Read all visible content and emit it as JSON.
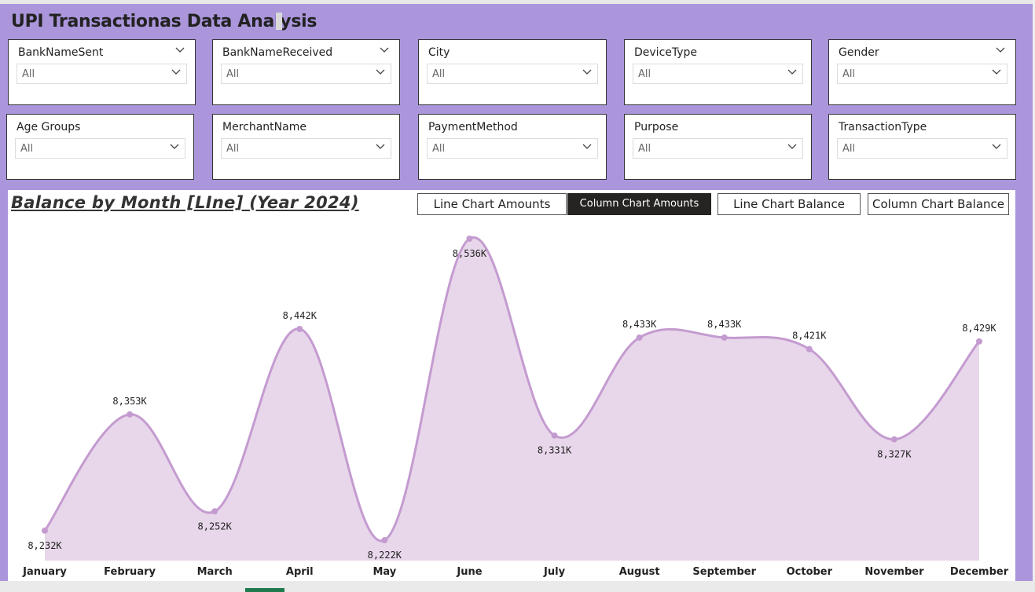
{
  "report_title": "UPI Transactionas Data Analysis",
  "slicers": [
    {
      "label": "BankNameSent",
      "value": "All",
      "header_chevron": true
    },
    {
      "label": "BankNameReceived",
      "value": "All",
      "header_chevron": true
    },
    {
      "label": "City",
      "value": "All",
      "header_chevron": false
    },
    {
      "label": "DeviceType",
      "value": "All",
      "header_chevron": false
    },
    {
      "label": "Gender",
      "value": "All",
      "header_chevron": true
    },
    {
      "label": "Age Groups",
      "value": "All",
      "header_chevron": false
    },
    {
      "label": "MerchantName",
      "value": "All",
      "header_chevron": false
    },
    {
      "label": "PaymentMethod",
      "value": "All",
      "header_chevron": false
    },
    {
      "label": "Purpose",
      "value": "All",
      "header_chevron": false
    },
    {
      "label": "TransactionType",
      "value": "All",
      "header_chevron": false
    }
  ],
  "buttons": [
    {
      "label": "Line Chart Amounts",
      "active": false
    },
    {
      "label": "Column Chart Amounts",
      "active": true
    },
    {
      "label": "Line Chart Balance",
      "active": false
    },
    {
      "label": "Column Chart Balance",
      "active": false
    }
  ],
  "colors": {
    "canvas": "#ab96dc",
    "line": "#c49bd0",
    "area": "#e8d7ea",
    "active_button": "#252423"
  },
  "chart_data": {
    "type": "area",
    "title": "Balance by Month [LIne] (Year 2024)",
    "xlabel": "",
    "ylabel": "",
    "categories": [
      "January",
      "February",
      "March",
      "April",
      "May",
      "June",
      "July",
      "August",
      "September",
      "October",
      "November",
      "December"
    ],
    "values": [
      8232,
      8353,
      8252,
      8442,
      8222,
      8536,
      8331,
      8433,
      8433,
      8421,
      8327,
      8429
    ],
    "data_labels": [
      "8,232K",
      "8,353K",
      "8,252K",
      "8,442K",
      "8,222K",
      "8,536K",
      "8,331K",
      "8,433K",
      "8,433K",
      "8,421K",
      "8,327K",
      "8,429K"
    ],
    "unit": "K",
    "grid": false,
    "legend": "none"
  }
}
